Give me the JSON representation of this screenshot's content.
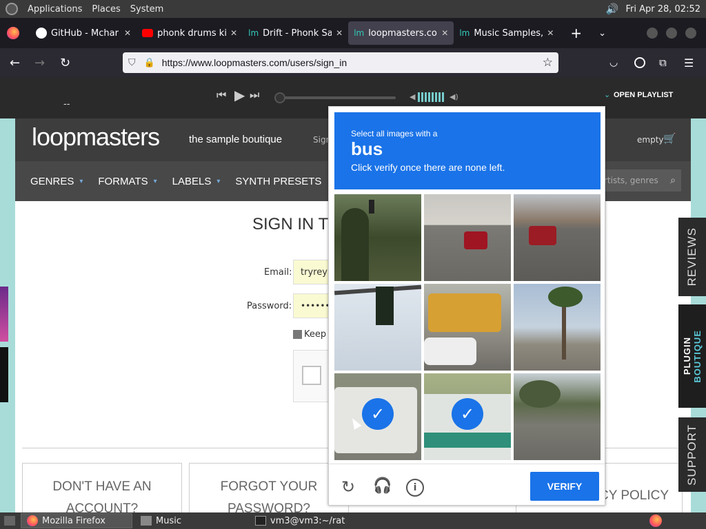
{
  "topbar": {
    "menus": [
      "Applications",
      "Places",
      "System"
    ],
    "clock": "Fri Apr 28, 02:52"
  },
  "tabs": [
    {
      "title": "GitHub - Mchar",
      "icon": "github-icon",
      "active": false
    },
    {
      "title": "phonk drums ki",
      "icon": "youtube-icon",
      "active": false
    },
    {
      "title": "Drift - Phonk Sa",
      "icon": "loopmasters-icon",
      "active": false
    },
    {
      "title": "loopmasters.co",
      "icon": "loopmasters-icon",
      "active": true
    },
    {
      "title": "Music Samples,",
      "icon": "loopmasters-icon",
      "active": false
    }
  ],
  "url": "https://www.loopmasters.com/users/sign_in",
  "player": {
    "open_playlist": "OPEN PLAYLIST",
    "time": "--"
  },
  "site": {
    "logo": "loopmasters",
    "tagline": "the sample boutique",
    "sign_partial": "Sign",
    "cart": "empty",
    "search_placeholder": "rtists, genres",
    "nav": [
      "GENRES",
      "FORMATS",
      "LABELS",
      "SYNTH PRESETS"
    ],
    "signin_title": "SIGN IN TO",
    "email_label": "Email:",
    "email_value": "tryreyrt",
    "password_label": "Password:",
    "password_value": "••••••••••",
    "keep_label": "Keep",
    "box1_line1": "DON'T HAVE AN",
    "box1_line2": "ACCOUNT?",
    "box2_line1": "FORGOT YOUR",
    "box2_line2": "PASSWORD?",
    "box3": "CY POLICY"
  },
  "sidetabs": {
    "reviews": "REVIEWS",
    "plugin1": "PLUGIN",
    "plugin2": "BOUTIQUE",
    "support": "SUPPORT"
  },
  "captcha": {
    "instruction": "Select all images with a",
    "target": "bus",
    "subtext": "Click verify once there are none left.",
    "verify": "VERIFY",
    "tiles": [
      {
        "label": "trees-traffic-light",
        "selected": false
      },
      {
        "label": "road-red-car",
        "selected": false
      },
      {
        "label": "street-red-car",
        "selected": false
      },
      {
        "label": "traffic-light-sky",
        "selected": false
      },
      {
        "label": "school-bus",
        "selected": false
      },
      {
        "label": "palm-tree-street",
        "selected": false
      },
      {
        "label": "white-van",
        "selected": true
      },
      {
        "label": "green-bus",
        "selected": true
      },
      {
        "label": "suburban-street",
        "selected": false
      }
    ]
  },
  "taskbar": {
    "items": [
      "Mozilla Firefox",
      "Music",
      "vm3@vm3:~/rat"
    ]
  }
}
